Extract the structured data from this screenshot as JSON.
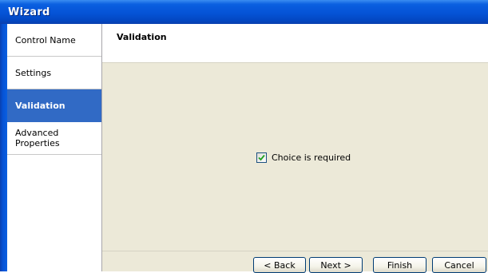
{
  "window": {
    "title": "Wizard"
  },
  "sidebar": {
    "items": [
      {
        "label": "Control Name",
        "active": false
      },
      {
        "label": "Settings",
        "active": false
      },
      {
        "label": "Validation",
        "active": true
      },
      {
        "label": "Advanced Properties",
        "active": false
      }
    ]
  },
  "main": {
    "header_title": "Validation",
    "checkbox": {
      "label": "Choice is required",
      "checked": true
    }
  },
  "buttons": {
    "back": "< Back",
    "next": "Next >",
    "finish": "Finish",
    "cancel": "Cancel"
  },
  "colors": {
    "titlebar": "#0553d6",
    "selection": "#316ac5",
    "dialog_background": "#ece9d8"
  }
}
